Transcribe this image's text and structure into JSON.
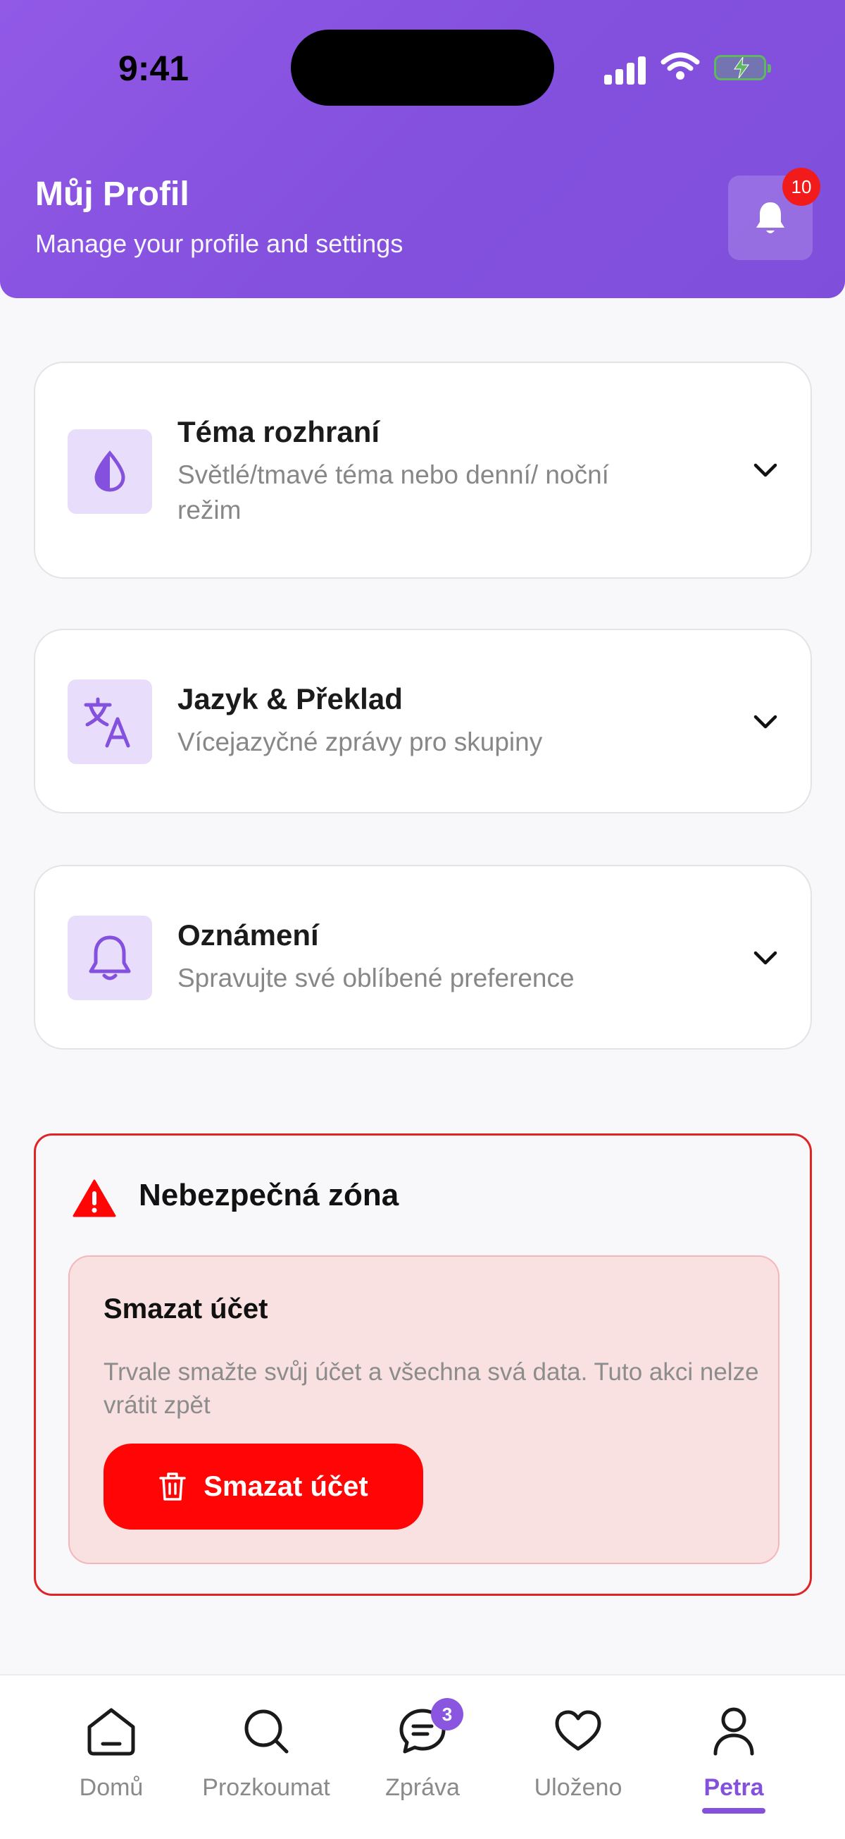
{
  "status_bar": {
    "time": "9:41"
  },
  "header": {
    "title": "Můj Profil",
    "subtitle": "Manage your profile and settings",
    "notification_count": "10"
  },
  "settings": [
    {
      "icon": "droplet-icon",
      "title": "Téma rozhraní",
      "subtitle": "Světlé/tmavé téma nebo denní/ noční režim"
    },
    {
      "icon": "translate-icon",
      "title": "Jazyk & Překlad",
      "subtitle": "Vícejazyčné zprávy pro skupiny"
    },
    {
      "icon": "bell-icon",
      "title": "Oznámení",
      "subtitle": "Spravujte své oblíbené preference"
    }
  ],
  "danger_zone": {
    "title": "Nebezpečná zóna",
    "box_title": "Smazat účet",
    "description": "Trvale smažte svůj účet a všechna svá data. Tuto akci nelze vrátit zpět",
    "button_label": "Smazat účet"
  },
  "nav": [
    {
      "icon": "home-icon",
      "label": "Domů"
    },
    {
      "icon": "search-icon",
      "label": "Prozkoumat"
    },
    {
      "icon": "message-icon",
      "label": "Zpráva",
      "badge": "3"
    },
    {
      "icon": "heart-icon",
      "label": "Uloženo"
    },
    {
      "icon": "user-icon",
      "label": "Petra",
      "active": true
    }
  ],
  "colors": {
    "primary": "#8450de",
    "danger": "#ff0505",
    "badge": "#f21b1b"
  }
}
